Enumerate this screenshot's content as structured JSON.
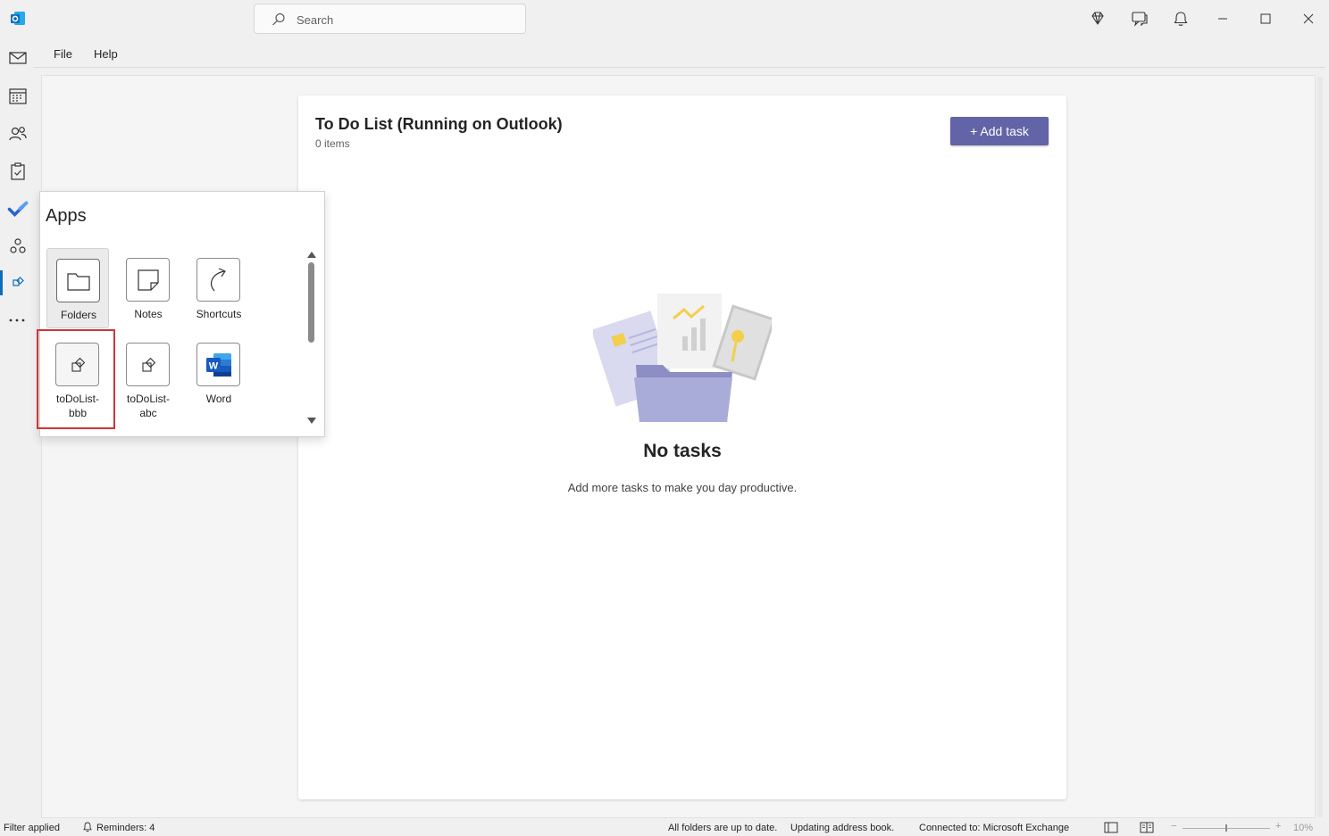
{
  "search": {
    "placeholder": "Search"
  },
  "menu": {
    "file": "File",
    "help": "Help"
  },
  "card": {
    "title": "To Do List (Running on Outlook)",
    "count": "0 items",
    "add_button": "+ Add task",
    "empty_title": "No tasks",
    "empty_subtitle": "Add more tasks to make you day productive."
  },
  "apps": {
    "title": "Apps",
    "items": [
      {
        "label": "Folders",
        "icon": "folder-icon"
      },
      {
        "label": "Notes",
        "icon": "note-icon"
      },
      {
        "label": "Shortcuts",
        "icon": "shortcut-arrow-icon"
      },
      {
        "label": "toDoList-\nbbb",
        "icon": "addin-icon"
      },
      {
        "label": "toDoList-\nabc",
        "icon": "addin-icon"
      },
      {
        "label": "Word",
        "icon": "word-icon"
      }
    ]
  },
  "status": {
    "filter": "Filter applied",
    "reminders": "Reminders: 4",
    "sync": "All folders are up to date.",
    "address_book": "Updating address book.",
    "connection": "Connected to: Microsoft Exchange",
    "zoom": "10%"
  },
  "colors": {
    "accent": "#6264a7",
    "highlight": "#d13438",
    "outlook_blue": "#0f6cbd"
  }
}
